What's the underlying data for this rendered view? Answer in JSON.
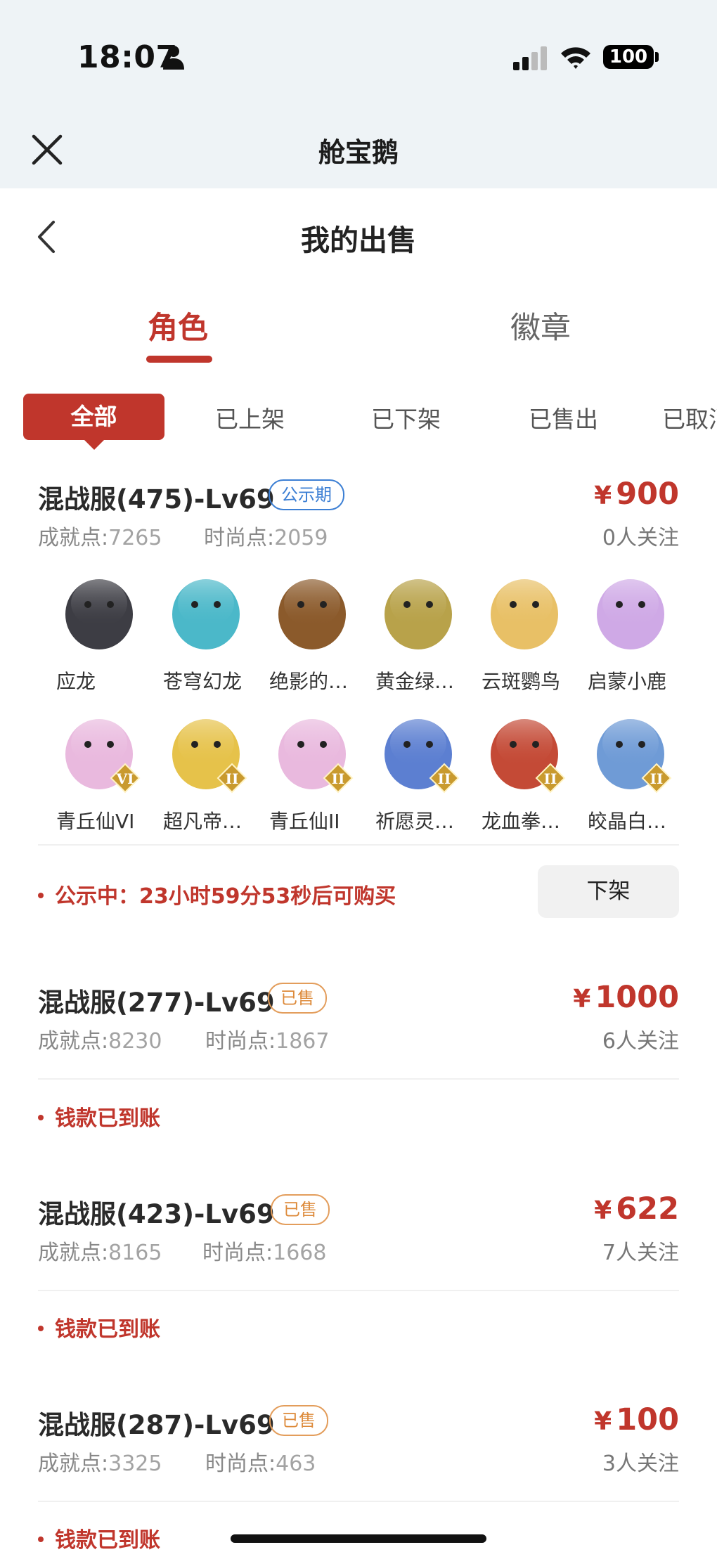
{
  "status_bar": {
    "time": "18:07",
    "battery": "100"
  },
  "app": {
    "title": "舱宝鹅"
  },
  "header": {
    "title": "我的出售"
  },
  "main_tabs": [
    {
      "label": "角色",
      "active": true
    },
    {
      "label": "徽章",
      "active": false
    }
  ],
  "filters": [
    {
      "label": "全部",
      "active": true
    },
    {
      "label": "已上架"
    },
    {
      "label": "已下架"
    },
    {
      "label": "已售出"
    },
    {
      "label": "已取消"
    }
  ],
  "listings": [
    {
      "server": "混战服(475)-Lv69",
      "badge": "公示期",
      "badge_type": "public",
      "price_symbol": "¥",
      "price": "900",
      "achievement_label": "成就点:",
      "achievement": "7265",
      "fashion_label": "时尚点:",
      "fashion": "2059",
      "followers": "0人关注",
      "status": "公示中：23小时59分53秒后可购买",
      "action": "下架",
      "items": [
        {
          "name": "应龙",
          "icon": "dragon-icon",
          "color": "#3d3d44"
        },
        {
          "name": "苍穹幻龙",
          "icon": "sky-dragon-icon",
          "color": "#4bb8c9"
        },
        {
          "name": "绝影的…",
          "icon": "capybara-icon",
          "color": "#8b5a2b"
        },
        {
          "name": "黄金绿…",
          "icon": "mantis-icon",
          "color": "#b8a24a"
        },
        {
          "name": "云斑鹦鸟",
          "icon": "parrot-icon",
          "color": "#e8c066"
        },
        {
          "name": "启蒙小鹿",
          "icon": "deer-icon",
          "color": "#cfa9e6"
        },
        {
          "name": "青丘仙VI",
          "icon": "fox-fairy-icon",
          "color": "#e9b9de",
          "tier": "VI"
        },
        {
          "name": "超凡帝…",
          "icon": "emperor-armor-icon",
          "color": "#e6c24a",
          "tier": "II"
        },
        {
          "name": "青丘仙II",
          "icon": "fox-fairy-icon",
          "color": "#e9b9de",
          "tier": "II"
        },
        {
          "name": "祈愿灵…",
          "icon": "griffin-icon",
          "color": "#5c7fd1",
          "tier": "II"
        },
        {
          "name": "龙血拳…",
          "icon": "bull-icon",
          "color": "#c44a36",
          "tier": "II"
        },
        {
          "name": "皎晶白…",
          "icon": "white-tiger-icon",
          "color": "#6f9bd6",
          "tier": "II"
        }
      ]
    },
    {
      "server": "混战服(277)-Lv69",
      "badge": "已售",
      "badge_type": "sold",
      "price_symbol": "¥",
      "price": "1000",
      "achievement_label": "成就点:",
      "achievement": "8230",
      "fashion_label": "时尚点:",
      "fashion": "1867",
      "followers": "6人关注",
      "status": "钱款已到账"
    },
    {
      "server": "混战服(423)-Lv69",
      "badge": "已售",
      "badge_type": "sold",
      "price_symbol": "¥",
      "price": "622",
      "achievement_label": "成就点:",
      "achievement": "8165",
      "fashion_label": "时尚点:",
      "fashion": "1668",
      "followers": "7人关注",
      "status": "钱款已到账"
    },
    {
      "server": "混战服(287)-Lv69",
      "badge": "已售",
      "badge_type": "sold",
      "price_symbol": "¥",
      "price": "100",
      "achievement_label": "成就点:",
      "achievement": "3325",
      "fashion_label": "时尚点:",
      "fashion": "463",
      "followers": "3人关注",
      "status": "钱款已到账"
    }
  ]
}
